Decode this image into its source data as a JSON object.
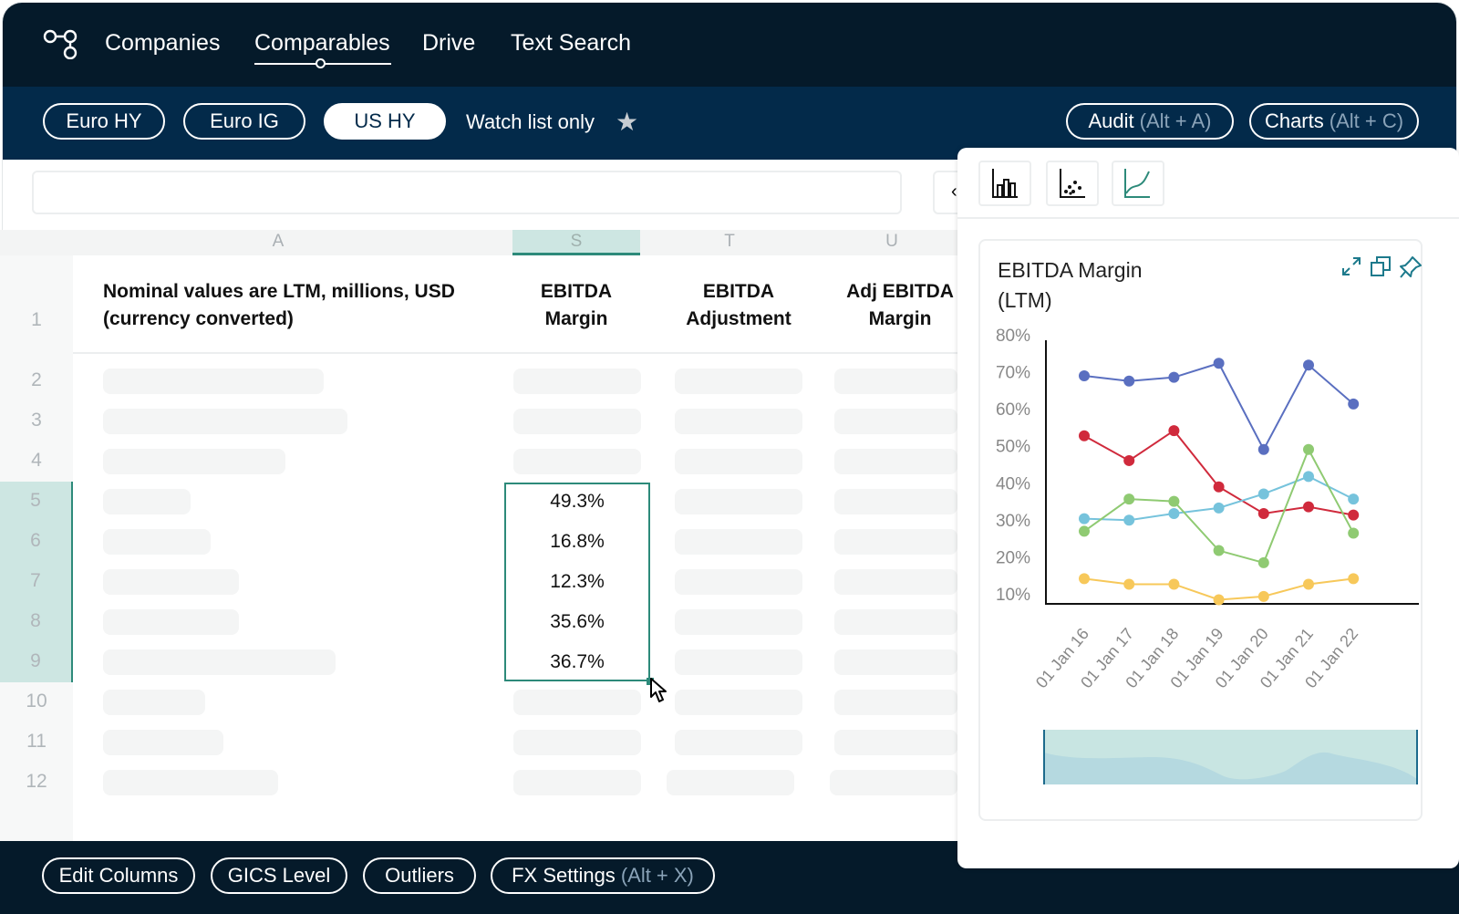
{
  "nav": {
    "items": [
      "Companies",
      "Comparables",
      "Drive",
      "Text Search"
    ],
    "active": "Comparables"
  },
  "filters": {
    "pills": [
      "Euro HY",
      "Euro IG",
      "US HY"
    ],
    "active": "US HY",
    "watch_label": "Watch list only"
  },
  "actions": {
    "audit": {
      "label": "Audit",
      "hint": "(Alt + A)"
    },
    "charts": {
      "label": "Charts",
      "hint": "(Alt + C)"
    }
  },
  "search": {
    "value": "",
    "placeholder": ""
  },
  "grid": {
    "column_letters": [
      "A",
      "S",
      "T",
      "U"
    ],
    "headers": [
      "Nominal values are LTM, millions, USD (currency converted)",
      "EBITDA Margin",
      "EBITDA Adjustment",
      "Adj EBITDA Margin"
    ],
    "row_numbers": [
      "1",
      "2",
      "3",
      "4",
      "5",
      "6",
      "7",
      "8",
      "9",
      "10",
      "11",
      "12"
    ],
    "selected_values": [
      "49.3%",
      "16.8%",
      "12.3%",
      "35.6%",
      "36.7%"
    ]
  },
  "bottom": {
    "edit_columns": "Edit Columns",
    "gics": "GICS Level",
    "outliers": "Outliers",
    "fx": {
      "label": "FX Settings",
      "hint": "(Alt + X)"
    }
  },
  "chart_panel": {
    "chart_types": [
      "bar-chart-icon",
      "scatter-chart-icon",
      "line-chart-icon"
    ],
    "active_type": "line"
  },
  "chart_data": {
    "type": "line",
    "title": "EBITDA Margin (LTM)",
    "title_lines": [
      "EBITDA Margin",
      "(LTM)"
    ],
    "categories": [
      "01 Jan 16",
      "01 Jan 17",
      "01 Jan 18",
      "01 Jan 19",
      "01 Jan 20",
      "01 Jan 21",
      "01 Jan 22"
    ],
    "y_ticks": [
      "80%",
      "70%",
      "60%",
      "50%",
      "40%",
      "30%",
      "20%",
      "10%"
    ],
    "ylim": [
      10,
      80
    ],
    "grid": false,
    "series": [
      {
        "color": "#5a6fc0",
        "values": [
          68.9,
          67.5,
          68.5,
          72.3,
          49.0,
          71.8,
          61.3
        ]
      },
      {
        "color": "#d02a3c",
        "values": [
          52.7,
          46.0,
          54.1,
          38.9,
          31.7,
          33.5,
          31.3
        ]
      },
      {
        "color": "#76c3dc",
        "values": [
          30.3,
          29.9,
          31.7,
          33.2,
          37.0,
          41.7,
          35.6
        ]
      },
      {
        "color": "#8fca72",
        "values": [
          26.9,
          35.6,
          35.0,
          21.7,
          18.4,
          49.0,
          26.4
        ]
      },
      {
        "color": "#f7c85a",
        "values": [
          14.1,
          12.6,
          12.6,
          8.4,
          9.3,
          12.6,
          14.1
        ]
      }
    ]
  },
  "colors": {
    "nav_bg": "#051a2a",
    "subbar_bg": "#032a4a",
    "accent": "#2d8a7a",
    "selection_bg": "#cde6e2"
  }
}
